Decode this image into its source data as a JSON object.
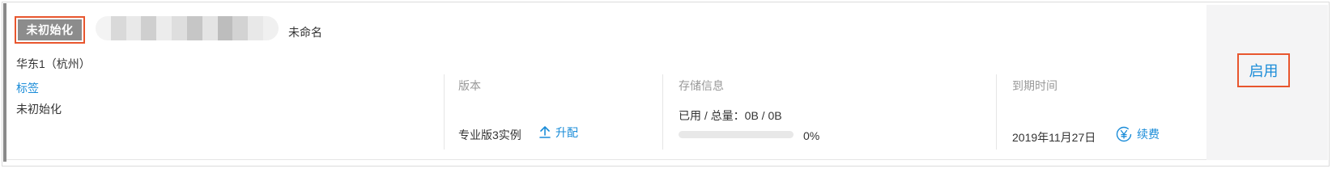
{
  "instance": {
    "status_badge": "未初始化",
    "name": "未命名",
    "region": "华东1（杭州）",
    "tag_label": "标签",
    "tag_value": "未初始化"
  },
  "columns": {
    "edition": {
      "header": "版本",
      "value": "专业版3实例",
      "upgrade_label": "升配"
    },
    "storage": {
      "header": "存储信息",
      "usage_text": "已用 / 总量：0B / 0B",
      "percent_text": "0%",
      "used_fraction": 0
    },
    "expiry": {
      "header": "到期时间",
      "date": "2019年11月27日",
      "renew_label": "续费"
    }
  },
  "actions": {
    "enable_label": "启用"
  },
  "colors": {
    "accent": "#1a8cd8",
    "highlight_border": "#e8562e",
    "badge_bg": "#8c8c8c",
    "side_bar": "#8a8a8a",
    "panel_bg": "#f4f4f5"
  },
  "icons": {
    "upgrade": "upgrade-arrow-icon",
    "renew": "yuan-currency-icon"
  }
}
